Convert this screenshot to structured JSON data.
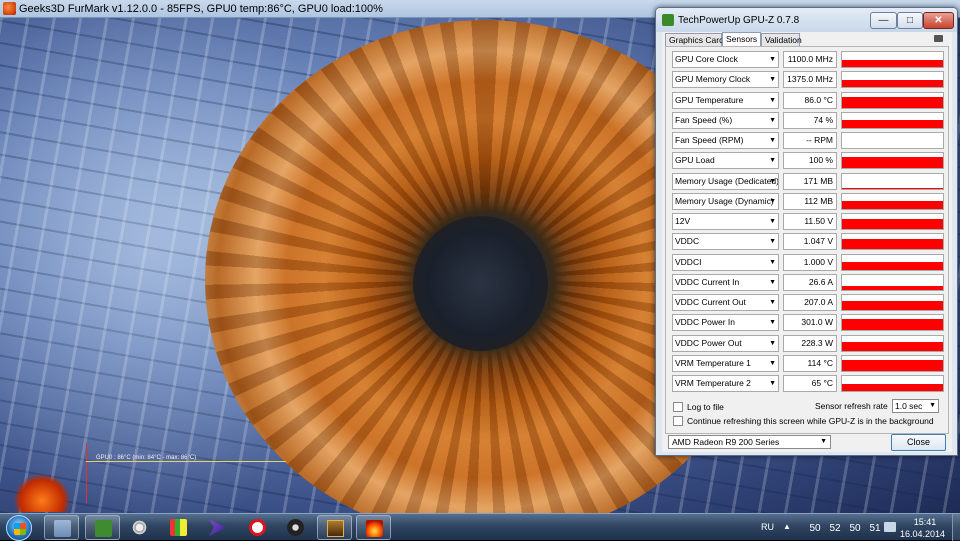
{
  "furmark": {
    "title": "Geeks3D FurMark v1.12.0.0 - 85FPS, GPU0 temp:86°C, GPU0 load:100%",
    "osd": "GPU0 : 86°C (min: 84°C - max: 86°C)"
  },
  "gpuz": {
    "title": "TechPowerUp GPU-Z 0.7.8",
    "window_buttons": {
      "minimize": "—",
      "maximize": "□",
      "close": "✕"
    },
    "tabs": [
      {
        "label": "Graphics Card"
      },
      {
        "label": "Sensors"
      },
      {
        "label": "Validation"
      }
    ],
    "active_tab": "Sensors",
    "sensors": [
      {
        "label": "GPU Core Clock",
        "value": "1100.0 MHz",
        "level": 0.45
      },
      {
        "label": "GPU Memory Clock",
        "value": "1375.0 MHz",
        "level": 0.45
      },
      {
        "label": "GPU Temperature",
        "value": "86.0 °C",
        "level": 0.7
      },
      {
        "label": "Fan Speed (%)",
        "value": "74 %",
        "level": 0.5
      },
      {
        "label": "Fan Speed (RPM)",
        "value": "-- RPM",
        "level": 0
      },
      {
        "label": "GPU Load",
        "value": "100 %",
        "level": 0.75
      },
      {
        "label": "Memory Usage (Dedicated)",
        "value": "171 MB",
        "level": 0.08
      },
      {
        "label": "Memory Usage (Dynamic)",
        "value": "112 MB",
        "level": 0.5
      },
      {
        "label": "12V",
        "value": "11.50 V",
        "level": 0.65
      },
      {
        "label": "VDDC",
        "value": "1.047 V",
        "level": 0.65
      },
      {
        "label": "VDDCI",
        "value": "1.000 V",
        "level": 0.55
      },
      {
        "label": "VDDC Current In",
        "value": "26.6 A",
        "level": 0.25
      },
      {
        "label": "VDDC Current Out",
        "value": "207.0 A",
        "level": 0.6
      },
      {
        "label": "VDDC Power In",
        "value": "301.0 W",
        "level": 0.7
      },
      {
        "label": "VDDC Power Out",
        "value": "228.3 W",
        "level": 0.6
      },
      {
        "label": "VRM Temperature 1",
        "value": "114 °C",
        "level": 0.7
      },
      {
        "label": "VRM Temperature 2",
        "value": "65 °C",
        "level": 0.45
      }
    ],
    "log_to_file_label": "Log to file",
    "refresh_label": "Sensor refresh rate",
    "refresh_value": "1.0 sec",
    "continue_label": "Continue refreshing this screen while GPU-Z is in the background",
    "gpu_select": "AMD Radeon R9 200 Series",
    "close_label": "Close",
    "graph_color": "#ff0000"
  },
  "taskbar": {
    "items": [
      {
        "icon": "windows-explorer-icon"
      },
      {
        "icon": "gpu-z-icon"
      },
      {
        "icon": "settings-gear-icon"
      },
      {
        "icon": "hwinfo-icon"
      },
      {
        "icon": "visual-studio-icon"
      },
      {
        "icon": "opera-icon"
      },
      {
        "icon": "steam-icon"
      },
      {
        "icon": "game-icon"
      },
      {
        "icon": "furmark-icon"
      }
    ],
    "lang": "RU",
    "tray_temps": [
      "50",
      "52",
      "50",
      "51"
    ],
    "clock_time": "15:41",
    "clock_date": "16.04.2014"
  }
}
